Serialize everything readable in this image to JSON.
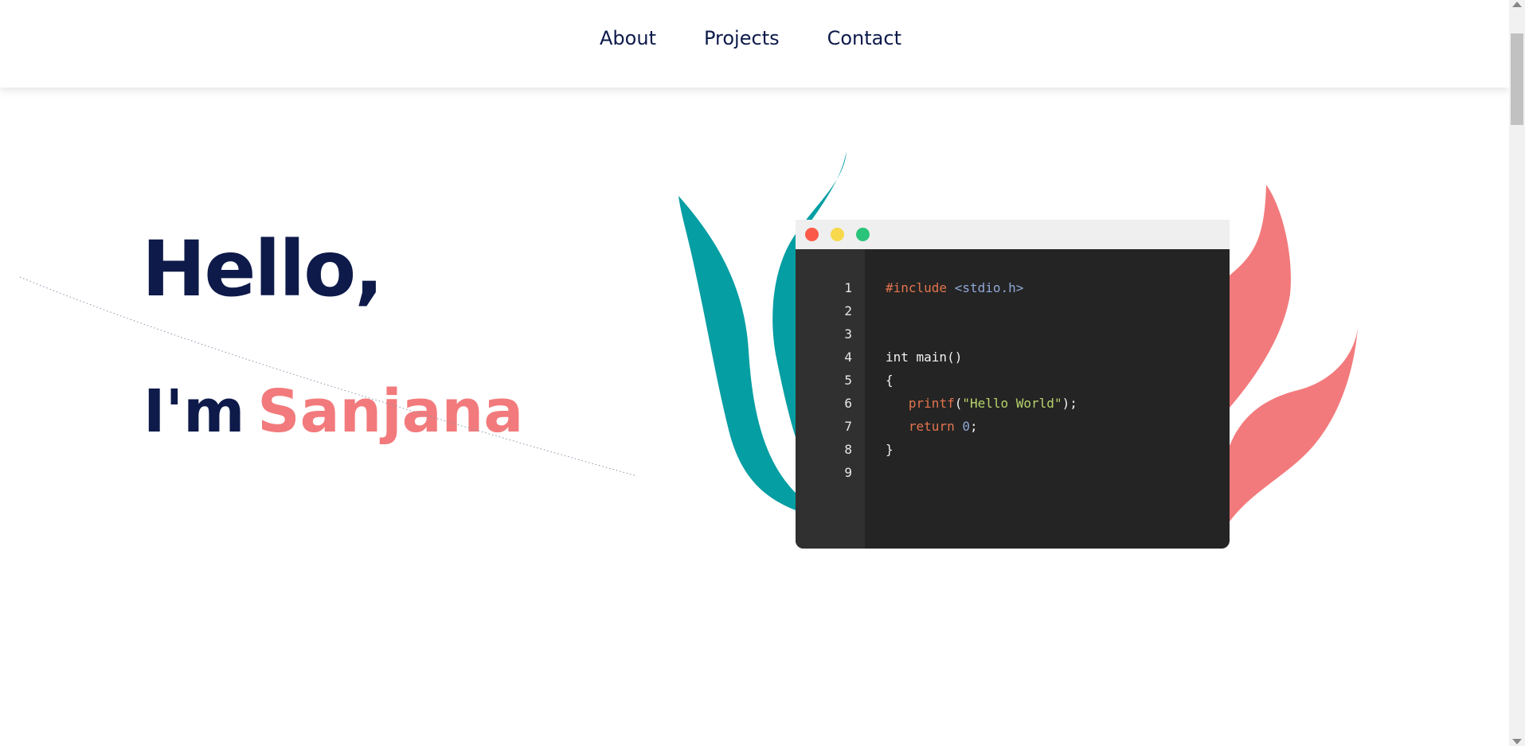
{
  "nav": {
    "items": [
      {
        "label": "About"
      },
      {
        "label": "Projects"
      },
      {
        "label": "Contact"
      }
    ]
  },
  "hero": {
    "greeting": "Hello,",
    "intro": "I'm",
    "name": "Sanjana"
  },
  "code_window": {
    "lines": [
      {
        "num": "1",
        "tokens": [
          {
            "text": "#include ",
            "kind": "directive"
          },
          {
            "text": "<stdio.h>",
            "kind": "header"
          }
        ]
      },
      {
        "num": "2",
        "tokens": []
      },
      {
        "num": "3",
        "tokens": []
      },
      {
        "num": "4",
        "tokens": [
          {
            "text": "int main()",
            "kind": "plain"
          }
        ]
      },
      {
        "num": "5",
        "tokens": [
          {
            "text": "{",
            "kind": "plain"
          }
        ]
      },
      {
        "num": "6",
        "tokens": [
          {
            "text": "   ",
            "kind": "plain"
          },
          {
            "text": "printf",
            "kind": "func"
          },
          {
            "text": "(",
            "kind": "plain"
          },
          {
            "text": "\"Hello World\"",
            "kind": "string"
          },
          {
            "text": ");",
            "kind": "plain"
          }
        ]
      },
      {
        "num": "7",
        "tokens": [
          {
            "text": "   ",
            "kind": "plain"
          },
          {
            "text": "return ",
            "kind": "keyword"
          },
          {
            "text": "0",
            "kind": "number"
          },
          {
            "text": ";",
            "kind": "plain"
          }
        ]
      },
      {
        "num": "8",
        "tokens": [
          {
            "text": "}",
            "kind": "plain"
          }
        ]
      },
      {
        "num": "9",
        "tokens": []
      }
    ]
  },
  "colors": {
    "navy": "#0d1a4a",
    "coral": "#f27a7c",
    "teal": "#059ea3",
    "editor_bg": "#242424",
    "gutter_bg": "#303030"
  },
  "icons": [
    "close-dot-icon",
    "minimize-dot-icon",
    "maximize-dot-icon"
  ]
}
